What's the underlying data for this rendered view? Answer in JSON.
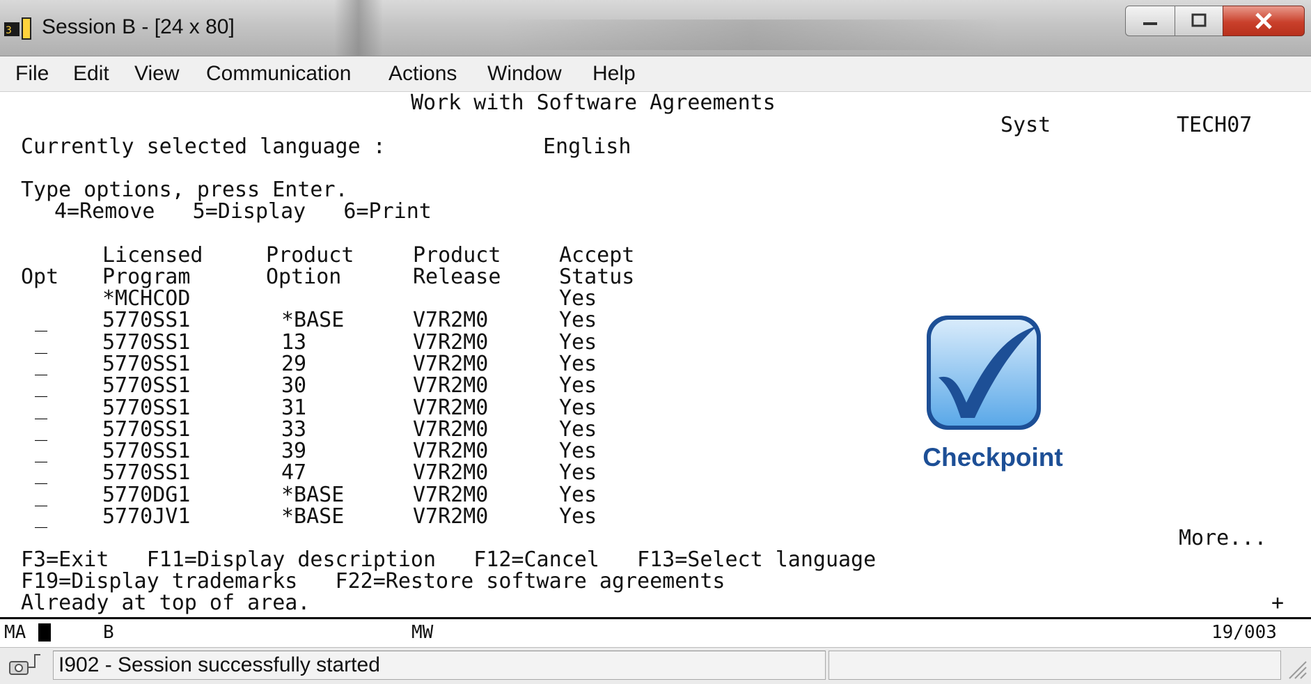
{
  "window": {
    "title": "Session B - [24 x 80]"
  },
  "menu": [
    "File",
    "Edit",
    "View",
    "Communication",
    "Actions",
    "Window",
    "Help"
  ],
  "screen": {
    "title": "Work with Software Agreements",
    "system_label": "Syst",
    "system_value": "TECH07",
    "language_prompt": "Currently selected language :",
    "language_value": "English",
    "instructions": "Type options, press Enter.",
    "options": "4=Remove   5=Display   6=Print",
    "headers": {
      "opt": "Opt",
      "program_1": "Licensed",
      "program_2": "Program",
      "option_1": "Product",
      "option_2": "Option",
      "release_1": "Product",
      "release_2": "Release",
      "status_1": "Accept",
      "status_2": "Status"
    },
    "rows": [
      {
        "opt": "",
        "program": "*MCHCOD",
        "option": "",
        "release": "",
        "status": "Yes"
      },
      {
        "opt": "_",
        "program": "5770SS1",
        "option": "*BASE",
        "release": "V7R2M0",
        "status": "Yes"
      },
      {
        "opt": "_",
        "program": "5770SS1",
        "option": "13",
        "release": "V7R2M0",
        "status": "Yes"
      },
      {
        "opt": "_",
        "program": "5770SS1",
        "option": "29",
        "release": "V7R2M0",
        "status": "Yes"
      },
      {
        "opt": "_",
        "program": "5770SS1",
        "option": "30",
        "release": "V7R2M0",
        "status": "Yes"
      },
      {
        "opt": "_",
        "program": "5770SS1",
        "option": "31",
        "release": "V7R2M0",
        "status": "Yes"
      },
      {
        "opt": "_",
        "program": "5770SS1",
        "option": "33",
        "release": "V7R2M0",
        "status": "Yes"
      },
      {
        "opt": "_",
        "program": "5770SS1",
        "option": "39",
        "release": "V7R2M0",
        "status": "Yes"
      },
      {
        "opt": "_",
        "program": "5770SS1",
        "option": "47",
        "release": "V7R2M0",
        "status": "Yes"
      },
      {
        "opt": "_",
        "program": "5770DG1",
        "option": "*BASE",
        "release": "V7R2M0",
        "status": "Yes"
      },
      {
        "opt": "_",
        "program": "5770JV1",
        "option": "*BASE",
        "release": "V7R2M0",
        "status": "Yes"
      }
    ],
    "more": "More...",
    "fkeys_1": "F3=Exit   F11=Display description   F12=Cancel   F13=Select language",
    "fkeys_2": "F19=Display trademarks   F22=Restore software agreements",
    "message": "Already at top of area.",
    "plus": "+"
  },
  "oia": {
    "mode": "MA",
    "session": "B",
    "indicator": "MW",
    "cursor_pos": "19/003"
  },
  "status": {
    "message": "I902 - Session successfully started"
  },
  "logo": {
    "text": "Checkpoint"
  },
  "colors": {
    "logo_blue": "#1d4f96",
    "close_red": "#c9402b"
  }
}
